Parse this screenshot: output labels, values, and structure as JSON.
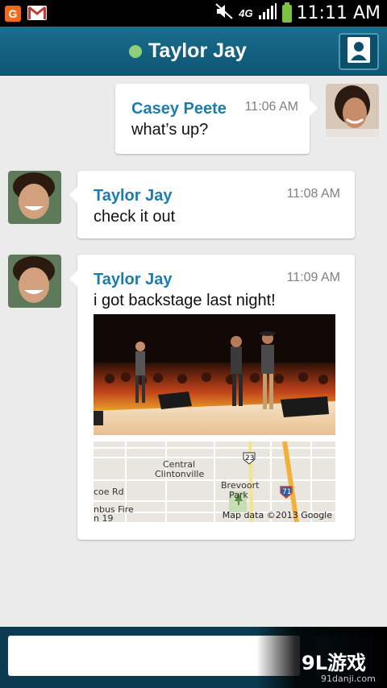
{
  "status_bar": {
    "notif_app_letter": "G",
    "network": "4G",
    "time": "11:11 AM"
  },
  "header": {
    "title": "Taylor Jay",
    "presence_color": "#8cd07c"
  },
  "messages": [
    {
      "sender": "Casey Peete",
      "time": "11:06 AM",
      "text": "what’s up?"
    },
    {
      "sender": "Taylor Jay",
      "time": "11:08 AM",
      "text": "check it out"
    },
    {
      "sender": "Taylor Jay",
      "time": "11:09 AM",
      "text": "i got backstage last night!"
    }
  ],
  "map": {
    "labels": {
      "central": "Central",
      "clintonville": "Clintonville",
      "brevoort": "Brevoort",
      "park": "Park",
      "route_23": "23",
      "route_71": "71",
      "coe_rd": "coe Rd",
      "nbus_fire": "nbus Fire",
      "n19": "n 19"
    },
    "attribution": "Map data ©2013 Google"
  },
  "compose": {
    "value": "",
    "placeholder": ""
  },
  "watermark": {
    "brand": "9L游戏",
    "url": "91danji.com"
  },
  "colors": {
    "accent": "#1a7db0",
    "header": "#0e5674",
    "background": "#ebebeb"
  }
}
